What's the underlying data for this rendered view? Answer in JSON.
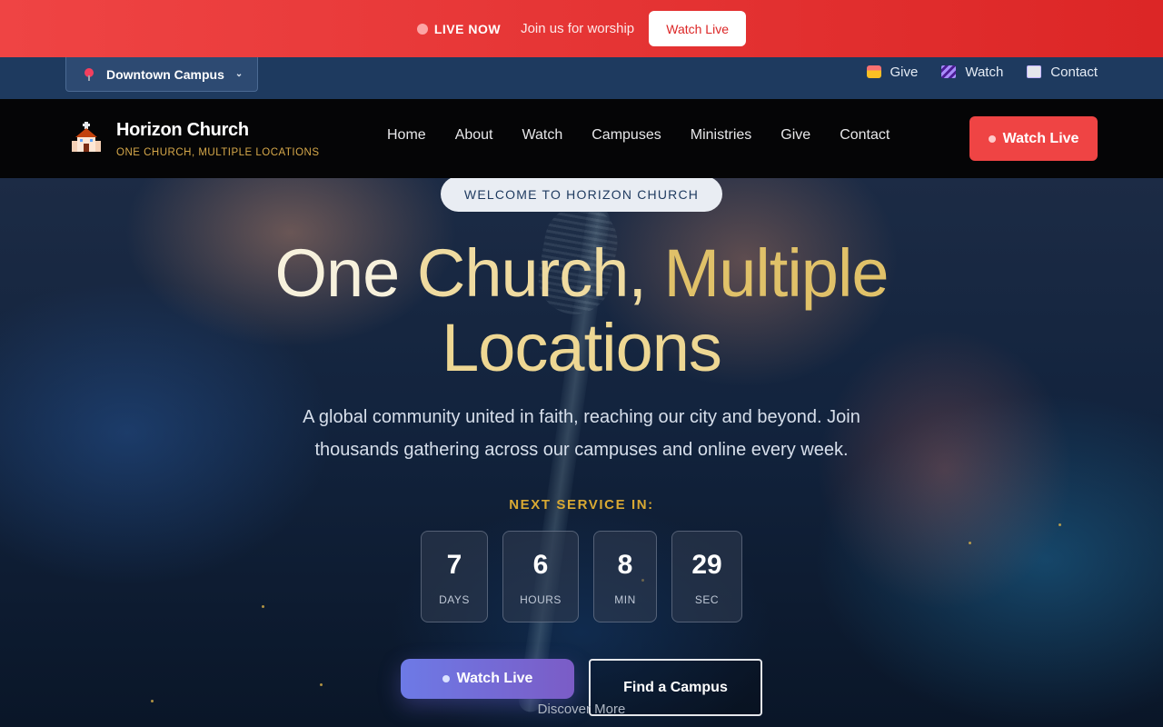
{
  "live_banner": {
    "live_label": "LIVE NOW",
    "message": "Join us for worship",
    "button_label": "Watch Live"
  },
  "utility_bar": {
    "campus_selector": "Downtown Campus",
    "links": [
      {
        "label": "Give",
        "icon": "gift-heart-icon"
      },
      {
        "label": "Watch",
        "icon": "clapperboard-icon"
      },
      {
        "label": "Contact",
        "icon": "envelope-icon"
      }
    ]
  },
  "nav": {
    "brand_name": "Horizon Church",
    "brand_tagline": "ONE CHURCH, MULTIPLE LOCATIONS",
    "logo_icon": "church-icon",
    "links": [
      "Home",
      "About",
      "Watch",
      "Campuses",
      "Ministries",
      "Give",
      "Contact"
    ],
    "cta_label": "Watch Live"
  },
  "hero": {
    "welcome_pill": "WELCOME TO HORIZON CHURCH",
    "title_words": [
      "One",
      "Church,",
      "Multiple",
      "Locations"
    ],
    "subtitle": "A global community united in faith, reaching our city and beyond. Join thousands gathering across our campuses and online every week.",
    "countdown_label": "NEXT SERVICE IN:",
    "countdown": [
      {
        "value": "7",
        "unit": "DAYS"
      },
      {
        "value": "6",
        "unit": "HOURS"
      },
      {
        "value": "8",
        "unit": "MIN"
      },
      {
        "value": "29",
        "unit": "SEC"
      }
    ],
    "primary_button": "Watch Live",
    "secondary_button": "Find a Campus",
    "discover_label": "Discover More"
  },
  "colors": {
    "live_red": "#ef4444",
    "accent_gold": "#d9a933",
    "nav_bg": "#050506",
    "utility_bg": "#1e3a5f"
  }
}
